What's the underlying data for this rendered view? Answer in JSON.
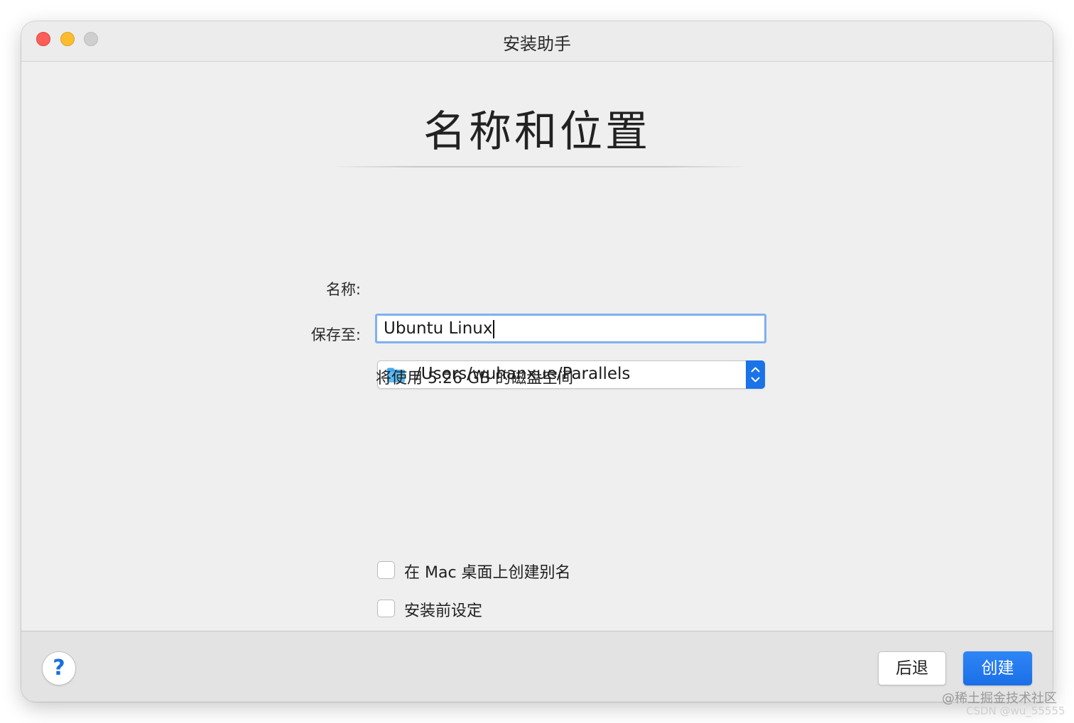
{
  "window": {
    "title": "安装助手"
  },
  "main": {
    "heading": "名称和位置",
    "name_label": "名称:",
    "name_value": "Ubuntu Linux",
    "save_label": "保存至:",
    "save_path": "/Users/wuhanxue/Parallels",
    "disk_note": "将使用 5.26 GB 的磁盘空间",
    "options": [
      {
        "label": "在 Mac 桌面上创建别名",
        "checked": false
      },
      {
        "label": "安装前设定",
        "checked": false
      }
    ]
  },
  "footer": {
    "help_label": "?",
    "back_label": "后退",
    "create_label": "创建"
  },
  "watermark": {
    "line1": "@稀土掘金技术社区",
    "line2": "CSDN @wu_55555"
  },
  "icons": {
    "folder": "folder-icon",
    "stepper": "chevron-up-down-icon"
  },
  "colors": {
    "accent": "#1a6fe6",
    "traffic_close": "#fc5f57",
    "traffic_minimize": "#fdbc2e",
    "traffic_zoom_disabled": "#cfcfcf",
    "focus_ring": "#7fb0f2"
  }
}
